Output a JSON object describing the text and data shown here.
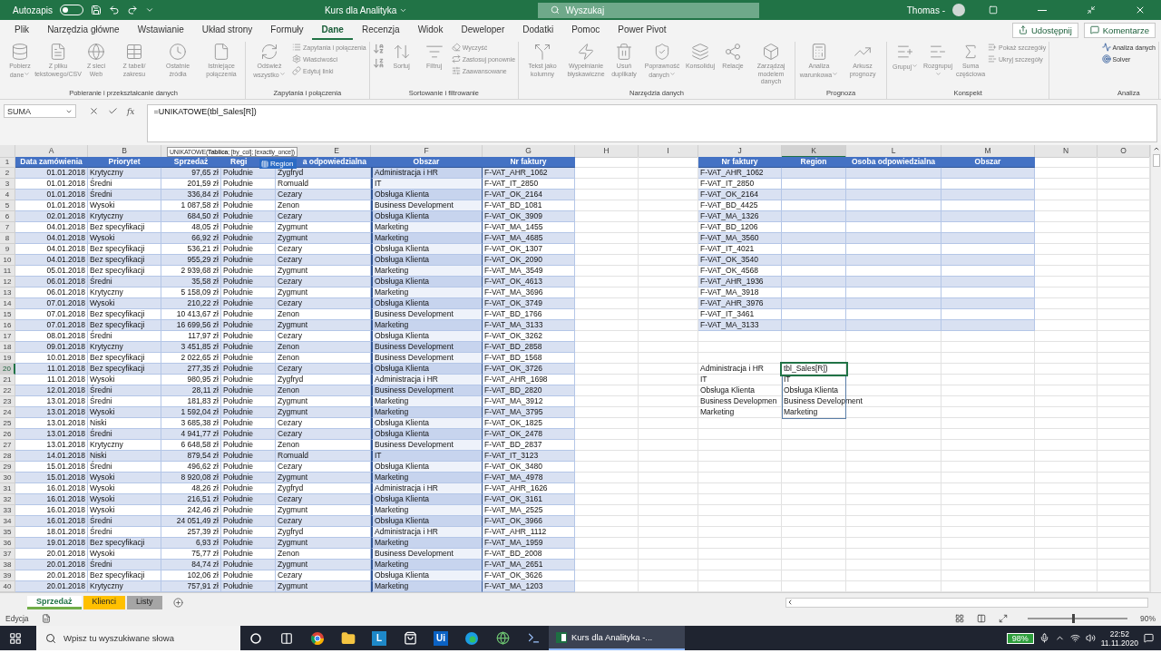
{
  "title_bar": {
    "autosave_label": "Autozapis",
    "autosave_on": false,
    "title": "Kurs dla Analityka",
    "search_placeholder": "Wyszukaj",
    "user": "Thomas -"
  },
  "menu": {
    "tabs": [
      {
        "label": "Plik",
        "selected": false
      },
      {
        "label": "Narzędzia główne",
        "selected": false
      },
      {
        "label": "Wstawianie",
        "selected": false
      },
      {
        "label": "Układ strony",
        "selected": false
      },
      {
        "label": "Formuły",
        "selected": false
      },
      {
        "label": "Dane",
        "selected": true
      },
      {
        "label": "Recenzja",
        "selected": false
      },
      {
        "label": "Widok",
        "selected": false
      },
      {
        "label": "Deweloper",
        "selected": false
      },
      {
        "label": "Dodatki",
        "selected": false
      },
      {
        "label": "Pomoc",
        "selected": false
      },
      {
        "label": "Power Pivot",
        "selected": false
      }
    ],
    "share": "Udostępnij",
    "comments": "Komentarze"
  },
  "ribbon": {
    "groups": [
      {
        "label": "Pobieranie i przekształcanie danych",
        "buttons": [
          {
            "kind": "large",
            "label": "Pobierz dane",
            "dropdown": true,
            "disabled": true
          },
          {
            "kind": "large",
            "label": "Z pliku tekstowego/CSV",
            "dropdown": false,
            "disabled": true
          },
          {
            "kind": "large",
            "label": "Z sieci Web",
            "dropdown": false,
            "disabled": true
          },
          {
            "kind": "large",
            "label": "Z tabeli/ zakresu",
            "dropdown": false,
            "disabled": true
          },
          {
            "kind": "large",
            "label": "Ostatnie źródła",
            "dropdown": false,
            "disabled": true
          },
          {
            "kind": "large",
            "label": "Istniejące połączenia",
            "dropdown": false,
            "disabled": true
          }
        ]
      },
      {
        "label": "Zapytania i połączenia",
        "buttons": [
          {
            "kind": "large",
            "label": "Odśwież wszystko",
            "dropdown": true,
            "disabled": true
          },
          {
            "kind": "small",
            "label": "Zapytania i połączenia",
            "disabled": true
          },
          {
            "kind": "small",
            "label": "Właściwości",
            "disabled": true
          },
          {
            "kind": "small",
            "label": "Edytuj linki",
            "disabled": true
          }
        ]
      },
      {
        "label": "Sortowanie i filtrowanie",
        "buttons": [
          {
            "kind": "icon",
            "disabled": true
          },
          {
            "kind": "icon",
            "disabled": true
          },
          {
            "kind": "large",
            "label": "Sortuj",
            "dropdown": false,
            "disabled": true
          },
          {
            "kind": "large",
            "label": "Filtruj",
            "dropdown": false,
            "disabled": true
          },
          {
            "kind": "small",
            "label": "Wyczyść",
            "disabled": true
          },
          {
            "kind": "small",
            "label": "Zastosuj ponownie",
            "disabled": true
          },
          {
            "kind": "small",
            "label": "Zaawansowane",
            "disabled": true
          }
        ]
      },
      {
        "label": "Narzędzia danych",
        "buttons": [
          {
            "kind": "large",
            "label": "Tekst jako kolumny",
            "dropdown": false,
            "disabled": true
          },
          {
            "kind": "large",
            "label": "Wypełnianie błyskawiczne",
            "dropdown": false,
            "disabled": true
          },
          {
            "kind": "large",
            "label": "Usuń duplikaty",
            "dropdown": false,
            "disabled": true
          },
          {
            "kind": "large",
            "label": "Poprawność danych",
            "dropdown": true,
            "disabled": true
          },
          {
            "kind": "large",
            "label": "Konsoliduj",
            "dropdown": false,
            "disabled": true
          },
          {
            "kind": "large",
            "label": "Relacje",
            "dropdown": false,
            "disabled": true
          },
          {
            "kind": "large",
            "label": "Zarządzaj modelem danych",
            "dropdown": false,
            "disabled": true
          }
        ]
      },
      {
        "label": "Prognoza",
        "buttons": [
          {
            "kind": "large",
            "label": "Analiza warunkowa",
            "dropdown": true,
            "disabled": true
          },
          {
            "kind": "large",
            "label": "Arkusz prognozy",
            "dropdown": false,
            "disabled": true
          }
        ]
      },
      {
        "label": "Konspekt",
        "buttons": [
          {
            "kind": "large",
            "label": "Grupuj",
            "dropdown": true,
            "disabled": true
          },
          {
            "kind": "large",
            "label": "Rozgrupuj",
            "dropdown": true,
            "disabled": true
          },
          {
            "kind": "large",
            "label": "Suma częściowa",
            "dropdown": false,
            "disabled": true
          },
          {
            "kind": "small",
            "label": "Pokaż szczegóły",
            "disabled": true
          },
          {
            "kind": "small",
            "label": "Ukryj szczegóły",
            "disabled": true
          }
        ]
      },
      {
        "label": "Analiza",
        "buttons": [
          {
            "kind": "small",
            "label": "Analiza danych",
            "disabled": false
          },
          {
            "kind": "small",
            "label": "Solver",
            "disabled": false
          }
        ]
      }
    ]
  },
  "formula_bar": {
    "name_box": "SUMA",
    "function_button": "fx",
    "formula": "=UNIKATOWE(tbl_Sales[R])"
  },
  "sheet": {
    "column_letters": [
      {
        "letter": "A",
        "selected": false
      },
      {
        "letter": "B",
        "selected": false
      },
      {
        "letter": "E",
        "selected": false
      },
      {
        "letter": "F",
        "selected": false
      },
      {
        "letter": "G",
        "selected": false
      },
      {
        "letter": "H",
        "selected": false
      },
      {
        "letter": "I",
        "selected": false
      },
      {
        "letter": "J",
        "selected": false
      },
      {
        "letter": "K",
        "selected": true
      },
      {
        "letter": "L",
        "selected": false
      },
      {
        "letter": "M",
        "selected": false
      },
      {
        "letter": "N",
        "selected": false
      },
      {
        "letter": "O",
        "selected": false
      }
    ],
    "row_numbers": [
      {
        "label": "1",
        "selected": false
      },
      {
        "label": "2",
        "selected": false
      },
      {
        "label": "3",
        "selected": false
      },
      {
        "label": "4",
        "selected": false
      },
      {
        "label": "5",
        "selected": false
      },
      {
        "label": "6",
        "selected": false
      },
      {
        "label": "7",
        "selected": false
      },
      {
        "label": "8",
        "selected": false
      },
      {
        "label": "9",
        "selected": false
      },
      {
        "label": "10",
        "selected": false
      },
      {
        "label": "11",
        "selected": false
      },
      {
        "label": "12",
        "selected": false
      },
      {
        "label": "13",
        "selected": false
      },
      {
        "label": "14",
        "selected": false
      },
      {
        "label": "15",
        "selected": false
      },
      {
        "label": "16",
        "selected": false
      },
      {
        "label": "17",
        "selected": false
      },
      {
        "label": "18",
        "selected": false
      },
      {
        "label": "19",
        "selected": false
      },
      {
        "label": "20",
        "selected": true
      },
      {
        "label": "21",
        "selected": false
      },
      {
        "label": "22",
        "selected": false
      },
      {
        "label": "23",
        "selected": false
      },
      {
        "label": "24",
        "selected": false
      },
      {
        "label": "25",
        "selected": false
      },
      {
        "label": "26",
        "selected": false
      },
      {
        "label": "27",
        "selected": false
      },
      {
        "label": "28",
        "selected": false
      },
      {
        "label": "29",
        "selected": false
      },
      {
        "label": "30",
        "selected": false
      },
      {
        "label": "31",
        "selected": false
      },
      {
        "label": "32",
        "selected": false
      },
      {
        "label": "33",
        "selected": false
      },
      {
        "label": "34",
        "selected": false
      },
      {
        "label": "35",
        "selected": false
      },
      {
        "label": "36",
        "selected": false
      },
      {
        "label": "37",
        "selected": false
      },
      {
        "label": "38",
        "selected": false
      },
      {
        "label": "39",
        "selected": false
      },
      {
        "label": "40",
        "selected": false
      }
    ],
    "sales_table": {
      "headers": [
        "Data zamówienia",
        "Priorytet",
        "Sprzedaż",
        "Regi",
        "a odpowiedzialna",
        "Obszar",
        "Nr faktury"
      ],
      "rows": [
        [
          "01.01.2018",
          "Krytyczny",
          "97,65 zł",
          "Południe",
          "Zygfryd",
          "Administracja i HR",
          "F-VAT_AHR_1062"
        ],
        [
          "01.01.2018",
          "Średni",
          "201,59 zł",
          "Południe",
          "Romuald",
          "IT",
          "F-VAT_IT_2850"
        ],
        [
          "01.01.2018",
          "Średni",
          "336,84 zł",
          "Południe",
          "Cezary",
          "Obsługa Klienta",
          "F-VAT_OK_2164"
        ],
        [
          "01.01.2018",
          "Wysoki",
          "1 087,58 zł",
          "Południe",
          "Zenon",
          "Business Development",
          "F-VAT_BD_1081"
        ],
        [
          "02.01.2018",
          "Krytyczny",
          "684,50 zł",
          "Południe",
          "Cezary",
          "Obsługa Klienta",
          "F-VAT_OK_3909"
        ],
        [
          "04.01.2018",
          "Bez specyfikacji",
          "48,05 zł",
          "Południe",
          "Zygmunt",
          "Marketing",
          "F-VAT_MA_1455"
        ],
        [
          "04.01.2018",
          "Wysoki",
          "66,92 zł",
          "Południe",
          "Zygmunt",
          "Marketing",
          "F-VAT_MA_4685"
        ],
        [
          "04.01.2018",
          "Bez specyfikacji",
          "536,21 zł",
          "Południe",
          "Cezary",
          "Obsługa Klienta",
          "F-VAT_OK_1307"
        ],
        [
          "04.01.2018",
          "Bez specyfikacji",
          "955,29 zł",
          "Południe",
          "Cezary",
          "Obsługa Klienta",
          "F-VAT_OK_2090"
        ],
        [
          "05.01.2018",
          "Bez specyfikacji",
          "2 939,68 zł",
          "Południe",
          "Zygmunt",
          "Marketing",
          "F-VAT_MA_3549"
        ],
        [
          "06.01.2018",
          "Średni",
          "35,58 zł",
          "Południe",
          "Cezary",
          "Obsługa Klienta",
          "F-VAT_OK_4613"
        ],
        [
          "06.01.2018",
          "Krytyczny",
          "5 158,09 zł",
          "Południe",
          "Zygmunt",
          "Marketing",
          "F-VAT_MA_3696"
        ],
        [
          "07.01.2018",
          "Wysoki",
          "210,22 zł",
          "Południe",
          "Cezary",
          "Obsługa Klienta",
          "F-VAT_OK_3749"
        ],
        [
          "07.01.2018",
          "Bez specyfikacji",
          "10 413,67 zł",
          "Południe",
          "Zenon",
          "Business Development",
          "F-VAT_BD_1766"
        ],
        [
          "07.01.2018",
          "Bez specyfikacji",
          "16 699,56 zł",
          "Południe",
          "Zygmunt",
          "Marketing",
          "F-VAT_MA_3133"
        ],
        [
          "08.01.2018",
          "Średni",
          "117,97 zł",
          "Południe",
          "Cezary",
          "Obsługa Klienta",
          "F-VAT_OK_3262"
        ],
        [
          "09.01.2018",
          "Krytyczny",
          "3 451,85 zł",
          "Południe",
          "Zenon",
          "Business Development",
          "F-VAT_BD_2858"
        ],
        [
          "10.01.2018",
          "Bez specyfikacji",
          "2 022,65 zł",
          "Południe",
          "Zenon",
          "Business Development",
          "F-VAT_BD_1568"
        ],
        [
          "11.01.2018",
          "Bez specyfikacji",
          "277,35 zł",
          "Południe",
          "Cezary",
          "Obsługa Klienta",
          "F-VAT_OK_3726"
        ],
        [
          "11.01.2018",
          "Wysoki",
          "980,95 zł",
          "Południe",
          "Zygfryd",
          "Administracja i HR",
          "F-VAT_AHR_1698"
        ],
        [
          "12.01.2018",
          "Średni",
          "28,11 zł",
          "Południe",
          "Zenon",
          "Business Development",
          "F-VAT_BD_2820"
        ],
        [
          "13.01.2018",
          "Średni",
          "181,83 zł",
          "Południe",
          "Zygmunt",
          "Marketing",
          "F-VAT_MA_3912"
        ],
        [
          "13.01.2018",
          "Wysoki",
          "1 592,04 zł",
          "Południe",
          "Zygmunt",
          "Marketing",
          "F-VAT_MA_3795"
        ],
        [
          "13.01.2018",
          "Niski",
          "3 685,38 zł",
          "Południe",
          "Cezary",
          "Obsługa Klienta",
          "F-VAT_OK_1825"
        ],
        [
          "13.01.2018",
          "Średni",
          "4 941,77 zł",
          "Południe",
          "Cezary",
          "Obsługa Klienta",
          "F-VAT_OK_2478"
        ],
        [
          "13.01.2018",
          "Krytyczny",
          "6 648,58 zł",
          "Południe",
          "Zenon",
          "Business Development",
          "F-VAT_BD_2837"
        ],
        [
          "14.01.2018",
          "Niski",
          "879,54 zł",
          "Południe",
          "Romuald",
          "IT",
          "F-VAT_IT_3123"
        ],
        [
          "15.01.2018",
          "Średni",
          "496,62 zł",
          "Południe",
          "Cezary",
          "Obsługa Klienta",
          "F-VAT_OK_3480"
        ],
        [
          "15.01.2018",
          "Wysoki",
          "8 920,08 zł",
          "Południe",
          "Zygmunt",
          "Marketing",
          "F-VAT_MA_4978"
        ],
        [
          "16.01.2018",
          "Wysoki",
          "48,26 zł",
          "Południe",
          "Zygfryd",
          "Administracja i HR",
          "F-VAT_AHR_1626"
        ],
        [
          "16.01.2018",
          "Wysoki",
          "216,51 zł",
          "Południe",
          "Cezary",
          "Obsługa Klienta",
          "F-VAT_OK_3161"
        ],
        [
          "16.01.2018",
          "Wysoki",
          "242,46 zł",
          "Południe",
          "Zygmunt",
          "Marketing",
          "F-VAT_MA_2525"
        ],
        [
          "16.01.2018",
          "Średni",
          "24 051,49 zł",
          "Południe",
          "Cezary",
          "Obsługa Klienta",
          "F-VAT_OK_3966"
        ],
        [
          "18.01.2018",
          "Średni",
          "257,39 zł",
          "Południe",
          "Zygfryd",
          "Administracja i HR",
          "F-VAT_AHR_1112"
        ],
        [
          "19.01.2018",
          "Bez specyfikacji",
          "6,93 zł",
          "Południe",
          "Zygmunt",
          "Marketing",
          "F-VAT_MA_1959"
        ],
        [
          "20.01.2018",
          "Wysoki",
          "75,77 zł",
          "Południe",
          "Zenon",
          "Business Development",
          "F-VAT_BD_2008"
        ],
        [
          "20.01.2018",
          "Średni",
          "84,74 zł",
          "Południe",
          "Zygmunt",
          "Marketing",
          "F-VAT_MA_2651"
        ],
        [
          "20.01.2018",
          "Bez specyfikacji",
          "102,06 zł",
          "Południe",
          "Cezary",
          "Obsługa Klienta",
          "F-VAT_OK_3626"
        ],
        [
          "20.01.2018",
          "Krytyczny",
          "757,91 zł",
          "Południe",
          "Zygmunt",
          "Marketing",
          "F-VAT_MA_1203"
        ]
      ]
    },
    "invoice_table": {
      "headers": [
        "Nr faktury",
        "Region",
        "Osoba odpowiedzialna",
        "Obszar"
      ],
      "rows": [
        "F-VAT_AHR_1062",
        "F-VAT_IT_2850",
        "F-VAT_OK_2164",
        "F-VAT_BD_4425",
        "F-VAT_MA_1326",
        "F-VAT_BD_1206",
        "F-VAT_MA_3560",
        "F-VAT_IT_4021",
        "F-VAT_OK_3540",
        "F-VAT_OK_4568",
        "F-VAT_AHR_1936",
        "F-VAT_MA_3918",
        "F-VAT_AHR_3976",
        "F-VAT_IT_3461",
        "F-VAT_MA_3133"
      ]
    },
    "area_list": {
      "labels": [
        "Administracja i HR",
        "IT",
        "Obsługa Klienta",
        "Business Developmen",
        "Marketing"
      ],
      "editing_cell": "tbl_Sales[R])",
      "spill_values": [
        "IT",
        "Obsługa Klienta",
        "Business Development",
        "Marketing"
      ]
    }
  },
  "function_tooltip": "UNIKATOWE(**Tablica**; [by_col]; [exactly_once])",
  "autocomplete": {
    "item": "Region"
  },
  "sheet_tabs": [
    {
      "label": "Sprzedaż",
      "selected": true,
      "color": "#70ad47"
    },
    {
      "label": "Klienci",
      "selected": false,
      "color": "#ffc000"
    },
    {
      "label": "Listy",
      "selected": false,
      "color": "#a5a5a5"
    }
  ],
  "status_bar": {
    "mode": "Edycja",
    "zoom_slider": {
      "level": 0.45
    },
    "zoom": "90%"
  },
  "taskbar": {
    "search_placeholder": "Wpisz tu wyszukiwane słowa",
    "apps": [
      {
        "kind": "circle"
      },
      {
        "kind": "taskview"
      },
      {
        "kind": "chrome"
      },
      {
        "kind": "folder"
      },
      {
        "kind": "letter",
        "label": "L",
        "color": "#1e88c8"
      },
      {
        "kind": "store"
      },
      {
        "kind": "letter",
        "label": "Ui",
        "color": "#0b62c4"
      },
      {
        "kind": "edge"
      },
      {
        "kind": "globe"
      },
      {
        "kind": "shell"
      }
    ],
    "excel_window": "Kurs dla Analityka -...",
    "battery": "98%",
    "time": "22:52",
    "date": "11.11.2020"
  }
}
